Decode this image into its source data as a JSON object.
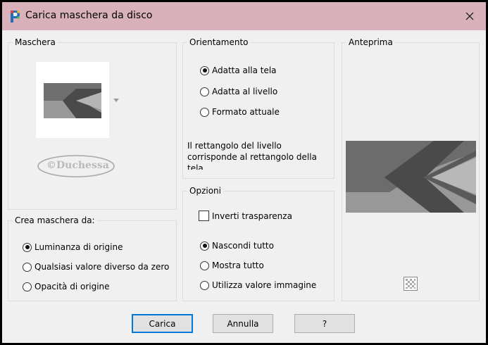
{
  "window": {
    "title": "Carica maschera da disco",
    "close_icon": "close-icon"
  },
  "maschera": {
    "label": "Maschera",
    "watermark_text": "©Duchessa"
  },
  "crea": {
    "label": "Crea maschera da:",
    "options": [
      "Luminanza di origine",
      "Qualsiasi valore diverso da zero",
      "Opacità di origine"
    ],
    "selected": 0
  },
  "orientamento": {
    "label": "Orientamento",
    "options": [
      "Adatta alla tela",
      "Adatta al livello",
      "Formato attuale"
    ],
    "selected": 0,
    "info": "Il rettangolo del livello corrisponde al rettangolo della tela"
  },
  "opzioni": {
    "label": "Opzioni",
    "invert_label": "Inverti trasparenza",
    "invert_checked": false,
    "options": [
      "Nascondi tutto",
      "Mostra tutto",
      "Utilizza valore immagine"
    ],
    "selected": 0
  },
  "anteprima": {
    "label": "Anteprima"
  },
  "buttons": {
    "load": "Carica",
    "cancel": "Annulla",
    "help": "?"
  },
  "colors": {
    "titlebar": "#d9b1bb",
    "window_bg": "#f0f0f0",
    "focus_border": "#0078d7"
  }
}
